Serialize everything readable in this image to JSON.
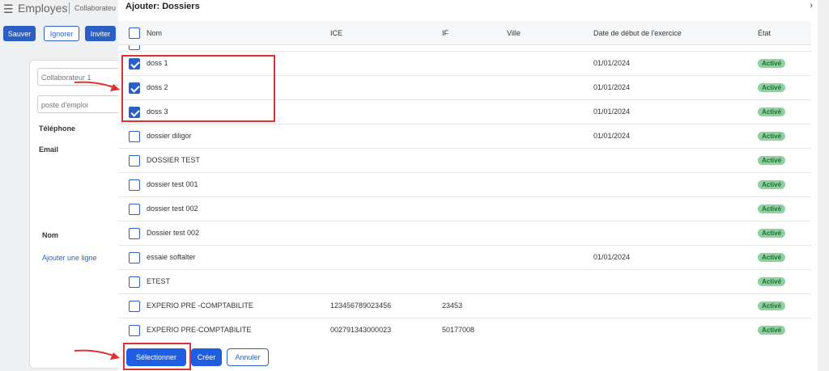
{
  "background": {
    "title": "Employes",
    "breadcrumb": "Collaborateu",
    "buttons": [
      "Sauver",
      "Ignorer",
      "Inviter"
    ],
    "fields": {
      "collaborateur": "Collaborateur 1",
      "poste": "poste d'emploi"
    },
    "labels": {
      "telephone": "Téléphone",
      "email": "Email",
      "nom": "Nom"
    },
    "add_line_link": "Ajouter une ligne"
  },
  "modal": {
    "title": "Ajouter: Dossiers",
    "close_icon": "chevron-right-icon",
    "columns": [
      "Nom",
      "ICE",
      "IF",
      "Ville",
      "Date de début de l'exercice",
      "État"
    ],
    "rows": [
      {
        "checked": true,
        "nom": "doss 1",
        "ice": "",
        "if": "",
        "ville": "",
        "date": "01/01/2024",
        "etat": "Activé"
      },
      {
        "checked": true,
        "nom": "doss 2",
        "ice": "",
        "if": "",
        "ville": "",
        "date": "01/01/2024",
        "etat": "Activé"
      },
      {
        "checked": true,
        "nom": "doss 3",
        "ice": "",
        "if": "",
        "ville": "",
        "date": "01/01/2024",
        "etat": "Activé"
      },
      {
        "checked": false,
        "nom": "dossier diligor",
        "ice": "",
        "if": "",
        "ville": "",
        "date": "01/01/2024",
        "etat": "Activé"
      },
      {
        "checked": false,
        "nom": "DOSSIER TEST",
        "ice": "",
        "if": "",
        "ville": "",
        "date": "",
        "etat": "Activé"
      },
      {
        "checked": false,
        "nom": "dossier test 001",
        "ice": "",
        "if": "",
        "ville": "",
        "date": "",
        "etat": "Activé"
      },
      {
        "checked": false,
        "nom": "dossier test 002",
        "ice": "",
        "if": "",
        "ville": "",
        "date": "",
        "etat": "Activé"
      },
      {
        "checked": false,
        "nom": "Dossier test 002",
        "ice": "",
        "if": "",
        "ville": "",
        "date": "",
        "etat": "Activé"
      },
      {
        "checked": false,
        "nom": "essaie softalter",
        "ice": "",
        "if": "",
        "ville": "",
        "date": "01/01/2024",
        "etat": "Activé"
      },
      {
        "checked": false,
        "nom": "ETEST",
        "ice": "",
        "if": "",
        "ville": "",
        "date": "",
        "etat": "Activé"
      },
      {
        "checked": false,
        "nom": "EXPERIO PRE -COMPTABILITE",
        "ice": "123456789023456",
        "if": "23453",
        "ville": "",
        "date": "",
        "etat": "Activé"
      },
      {
        "checked": false,
        "nom": "EXPERIO PRE-COMPTABILITE",
        "ice": "002791343000023",
        "if": "50177008",
        "ville": "",
        "date": "",
        "etat": "Activé"
      }
    ],
    "footer": {
      "select": "Sélectionner",
      "create": "Créer",
      "cancel": "Annuler"
    }
  },
  "colors": {
    "primary": "#1f5ee0",
    "badge_bg": "#8fd19e",
    "badge_text": "#1f6f35",
    "annotation": "#e03131"
  }
}
